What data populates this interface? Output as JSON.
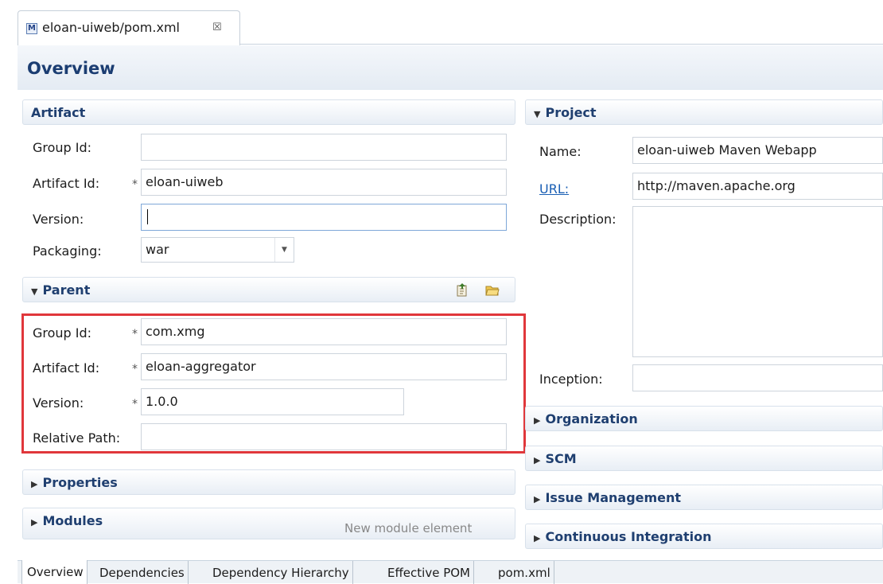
{
  "editor": {
    "tab_title": "eloan-uiweb/pom.xml",
    "tab_icon": "maven-m-icon",
    "close_glyph": "☒"
  },
  "overview": {
    "title": "Overview"
  },
  "artifact": {
    "title": "Artifact",
    "group_id_label": "Group Id:",
    "group_id_value": "",
    "artifact_id_label": "Artifact Id:",
    "artifact_id_value": "eloan-uiweb",
    "version_label": "Version:",
    "version_value": "",
    "packaging_label": "Packaging:",
    "packaging_value": "war"
  },
  "parent": {
    "title": "Parent",
    "group_id_label": "Group Id:",
    "group_id_value": "com.xmg",
    "artifact_id_label": "Artifact Id:",
    "artifact_id_value": "eloan-aggregator",
    "version_label": "Version:",
    "version_value": "1.0.0",
    "relative_path_label": "Relative Path:",
    "relative_path_value": ""
  },
  "properties": {
    "title": "Properties"
  },
  "modules": {
    "title": "Modules",
    "hint": "New module element"
  },
  "project": {
    "title": "Project",
    "name_label": "Name:",
    "name_value": "eloan-uiweb Maven Webapp",
    "url_label": "URL:",
    "url_value": "http://maven.apache.org",
    "description_label": "Description:",
    "description_value": "",
    "inception_label": "Inception:",
    "inception_value": ""
  },
  "collapsed_sections": {
    "organization": "Organization",
    "scm": "SCM",
    "issue_management": "Issue Management",
    "continuous_integration": "Continuous Integration"
  },
  "bottom_tabs": [
    "Overview",
    "Dependencies",
    "Dependency Hierarchy",
    "Effective POM",
    "pom.xml"
  ],
  "required_marker": "*",
  "colors": {
    "highlight": "#e0373b",
    "section_title": "#1f3f70",
    "link": "#1a5fb4"
  }
}
